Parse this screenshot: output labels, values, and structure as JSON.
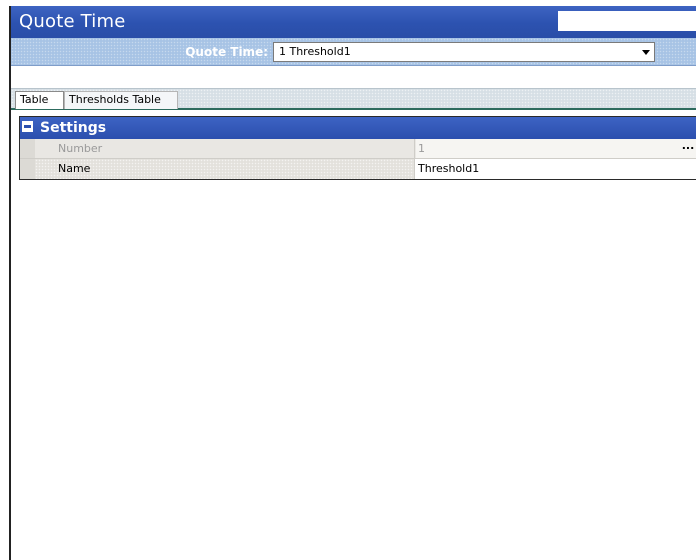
{
  "window": {
    "title": "Quote Time"
  },
  "selector": {
    "label": "Quote Time:",
    "value": "1 Threshold1"
  },
  "tabs": [
    {
      "label": "Table",
      "selected": true
    },
    {
      "label": "Thresholds Table",
      "selected": false
    }
  ],
  "grid": {
    "category": "Settings",
    "rows": [
      {
        "name": "Number",
        "value": "1",
        "readonly": true
      },
      {
        "name": "Name",
        "value": "Threshold1",
        "readonly": false
      }
    ]
  },
  "icons": {
    "collapse": "minus-box-icon",
    "dropdown": "chevron-down-icon",
    "ellipsis": "ellipsis-icon"
  },
  "colors": {
    "title_bar": "#2c52b0",
    "selector_bar": "#a7c3e5",
    "category_header": "#2b4fae",
    "tab_underline": "#2d6b5e"
  }
}
